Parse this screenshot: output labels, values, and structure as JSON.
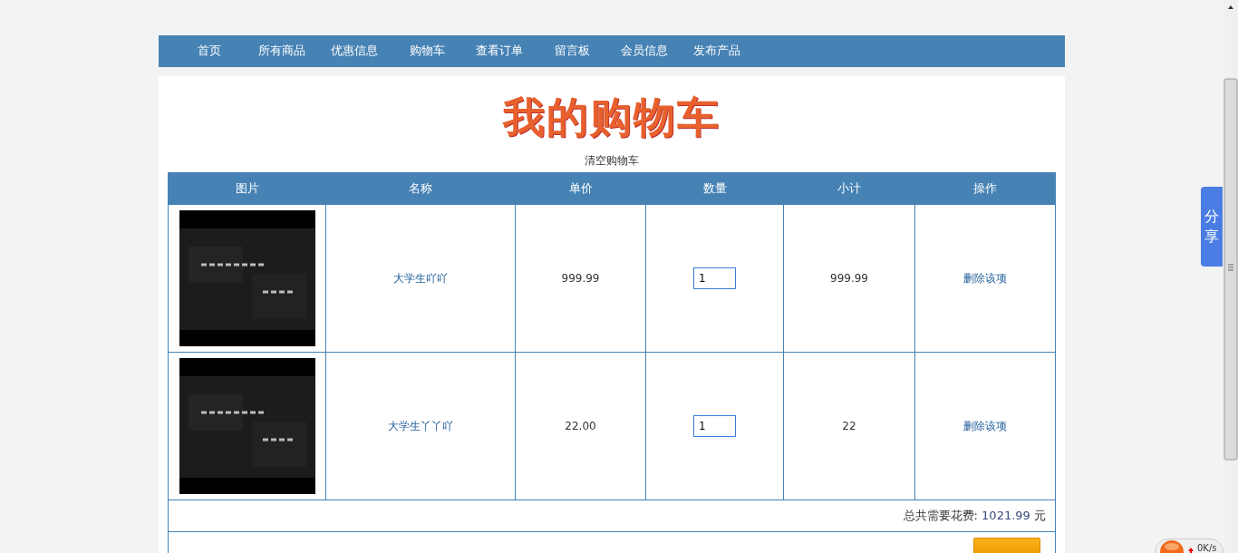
{
  "nav": [
    {
      "label": "首页"
    },
    {
      "label": "所有商品"
    },
    {
      "label": "优惠信息"
    },
    {
      "label": "购物车"
    },
    {
      "label": "查看订单"
    },
    {
      "label": "留言板"
    },
    {
      "label": "会员信息"
    },
    {
      "label": "发布产品"
    }
  ],
  "heading": "我的购物车",
  "clear_link": "清空购物车",
  "table": {
    "columns": [
      "图片",
      "名称",
      "单价",
      "数量",
      "小计",
      "操作"
    ],
    "rows": [
      {
        "name": "大学生吖吖",
        "price": "999.99",
        "quantity": "1",
        "subtotal": "999.99",
        "action": "删除该项"
      },
      {
        "name": "大学生丫丫吖",
        "price": "22.00",
        "quantity": "1",
        "subtotal": "22",
        "action": "删除该项"
      }
    ],
    "total_label": "总共需要花费:",
    "total": "1021.99",
    "currency": "元"
  },
  "share_tab": "分享",
  "speed_widget": "0K/s"
}
